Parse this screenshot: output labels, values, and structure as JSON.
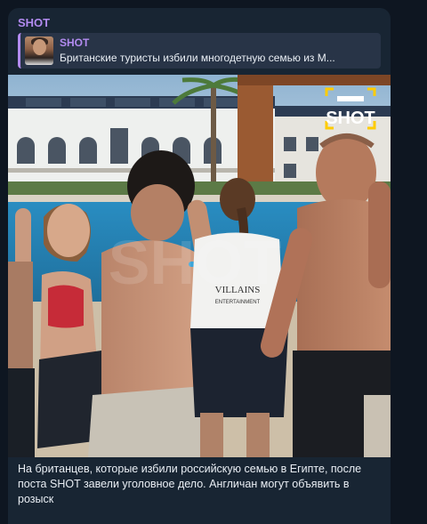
{
  "channel": {
    "name": "SHOT"
  },
  "reply": {
    "title": "SHOT",
    "text": "Британские туристы избили многодетную семью из М..."
  },
  "media": {
    "watermark_logo": "SHOT",
    "print_brand": "VILLAINS",
    "print_sub": "ENTERTAINMENT"
  },
  "post": {
    "caption": "На британцев, которые избили российскую семью в Египте, после поста SHOT завели уголовное дело. Англичан могут объявить в розыск"
  },
  "colors": {
    "chat_bg": "#0e1621",
    "bubble_bg": "#182533",
    "reply_bg": "#283447",
    "accent": "#b28bf0",
    "text": "#e9eef4"
  },
  "icons": [
    "shot-logo-icon",
    "reply-thumbnail"
  ]
}
